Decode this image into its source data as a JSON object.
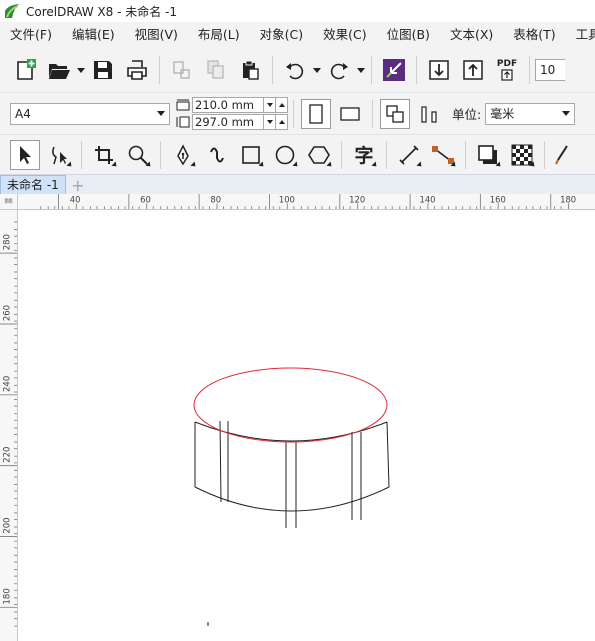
{
  "window": {
    "title": "CorelDRAW X8 - 未命名 -1"
  },
  "menu": [
    {
      "label": "文件(F)"
    },
    {
      "label": "编辑(E)"
    },
    {
      "label": "视图(V)"
    },
    {
      "label": "布局(L)"
    },
    {
      "label": "对象(C)"
    },
    {
      "label": "效果(C)"
    },
    {
      "label": "位图(B)"
    },
    {
      "label": "文本(X)"
    },
    {
      "label": "表格(T)"
    },
    {
      "label": "工具(O)"
    }
  ],
  "toolbar": {
    "pdf_label": "PDF",
    "zoom_value": "10"
  },
  "property_bar": {
    "page_size": "A4",
    "width": "210.0 mm",
    "height": "297.0 mm",
    "unit_label": "单位:",
    "unit_value": "毫米"
  },
  "toolbox": {
    "text_tool_glyph": "字"
  },
  "document_tab": {
    "label": "未命名 -1",
    "add_label": "+"
  },
  "rulers": {
    "corner": "㎜",
    "horizontal_ticks": [
      "40",
      "60",
      "80",
      "100",
      "120",
      "140",
      "160",
      "180"
    ],
    "vertical_ticks": [
      "280",
      "260",
      "240",
      "220",
      "200",
      "180"
    ]
  },
  "colors": {
    "ellipse_stroke": "#e02b3c",
    "line_stroke": "#222222",
    "accent_purple": "#5a2d82",
    "tab_active": "#cfe2f8"
  }
}
